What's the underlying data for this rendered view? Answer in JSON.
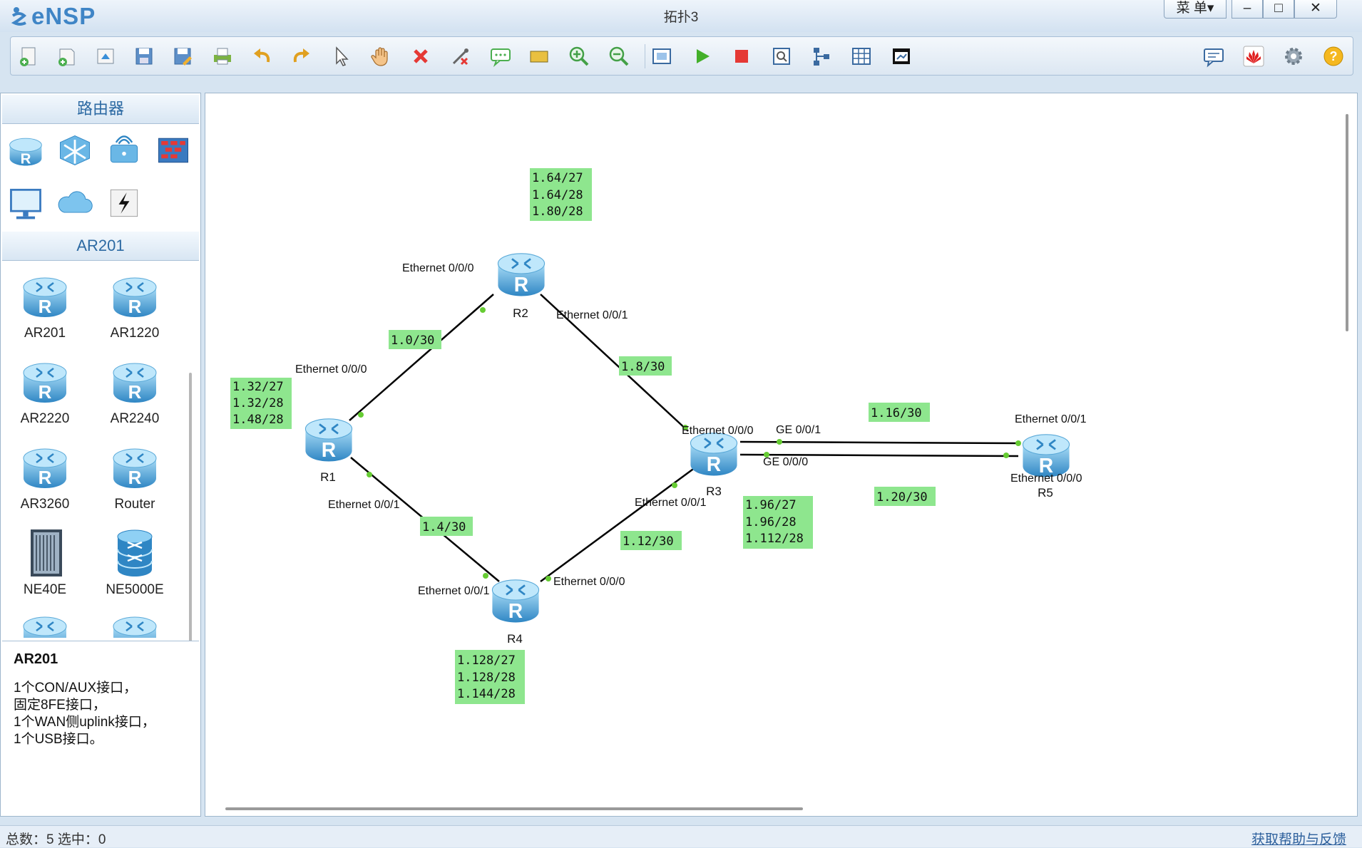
{
  "app": {
    "logo_text": "eNSP",
    "window_title": "拓扑3",
    "menu_label": "菜 单▾",
    "min_glyph": "–",
    "max_glyph": "□",
    "close_glyph": "✕"
  },
  "palette": {
    "section1_title": "路由器",
    "section2_title": "AR201",
    "devices": [
      {
        "label": "AR201"
      },
      {
        "label": "AR1220"
      },
      {
        "label": "AR2220"
      },
      {
        "label": "AR2240"
      },
      {
        "label": "AR3260"
      },
      {
        "label": "Router"
      },
      {
        "label": "NE40E"
      },
      {
        "label": "NE5000E"
      }
    ],
    "description": {
      "title": "AR201",
      "lines": [
        "1个CON/AUX接口，",
        "固定8FE接口，",
        "1个WAN侧uplink接口，",
        "1个USB接口。"
      ]
    }
  },
  "topology": {
    "routers": [
      {
        "name": "R1"
      },
      {
        "name": "R2"
      },
      {
        "name": "R3"
      },
      {
        "name": "R4"
      },
      {
        "name": "R5"
      }
    ],
    "port_labels": {
      "r2_e000": "Ethernet 0/0/0",
      "r2_e001": "Ethernet 0/0/1",
      "r1_e000": "Ethernet 0/0/0",
      "r1_e001": "Ethernet 0/0/1",
      "r3_e000": "Ethernet 0/0/0",
      "r3_ge001": "GE 0/0/1",
      "r3_ge000": "GE 0/0/0",
      "r3_e001": "Ethernet 0/0/1",
      "r5_e001": "Ethernet 0/0/1",
      "r5_e000": "Ethernet 0/0/0",
      "r4_e001": "Ethernet 0/0/1",
      "r4_e000": "Ethernet 0/0/0"
    },
    "link_subnets": {
      "r1_r2": "1.0/30",
      "r2_r3": "1.8/30",
      "r1_r4": "1.4/30",
      "r4_r3": "1.12/30",
      "r3_r5_a": "1.16/30",
      "r3_r5_b": "1.20/30"
    },
    "loopbacks": {
      "r2": [
        "1.64/27",
        "1.64/28",
        "1.80/28"
      ],
      "r1": [
        "1.32/27",
        "1.32/28",
        "1.48/28"
      ],
      "r3": [
        "1.96/27",
        "1.96/28",
        "1.112/28"
      ],
      "r4": [
        "1.128/27",
        "1.128/28",
        "1.144/28"
      ]
    }
  },
  "status": {
    "summary": "总数：5  选中：0",
    "help_link": "获取帮助与反馈"
  },
  "colors": {
    "label_green": "#8ee68e",
    "router_blue": "#5fb2e6",
    "port_dot": "#66cc33"
  }
}
